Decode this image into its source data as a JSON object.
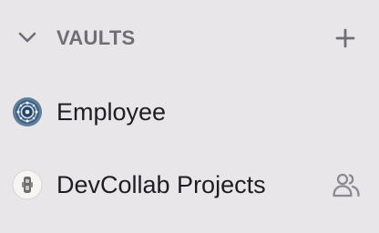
{
  "sidebar": {
    "vaults_section": {
      "title": "VAULTS",
      "collapse_icon": "chevron-down-icon",
      "add_icon": "plus-icon",
      "items": [
        {
          "label": "Employee",
          "icon": "employee-vault-icon",
          "shared": false
        },
        {
          "label": "DevCollab Projects",
          "icon": "devcollab-vault-icon",
          "shared": true,
          "shared_icon": "people-icon"
        }
      ]
    }
  },
  "colors": {
    "background": "#e8e6e8",
    "muted_text": "#6f6e74",
    "primary_text": "#1e1e22",
    "icon_gray": "#8b8a90"
  }
}
